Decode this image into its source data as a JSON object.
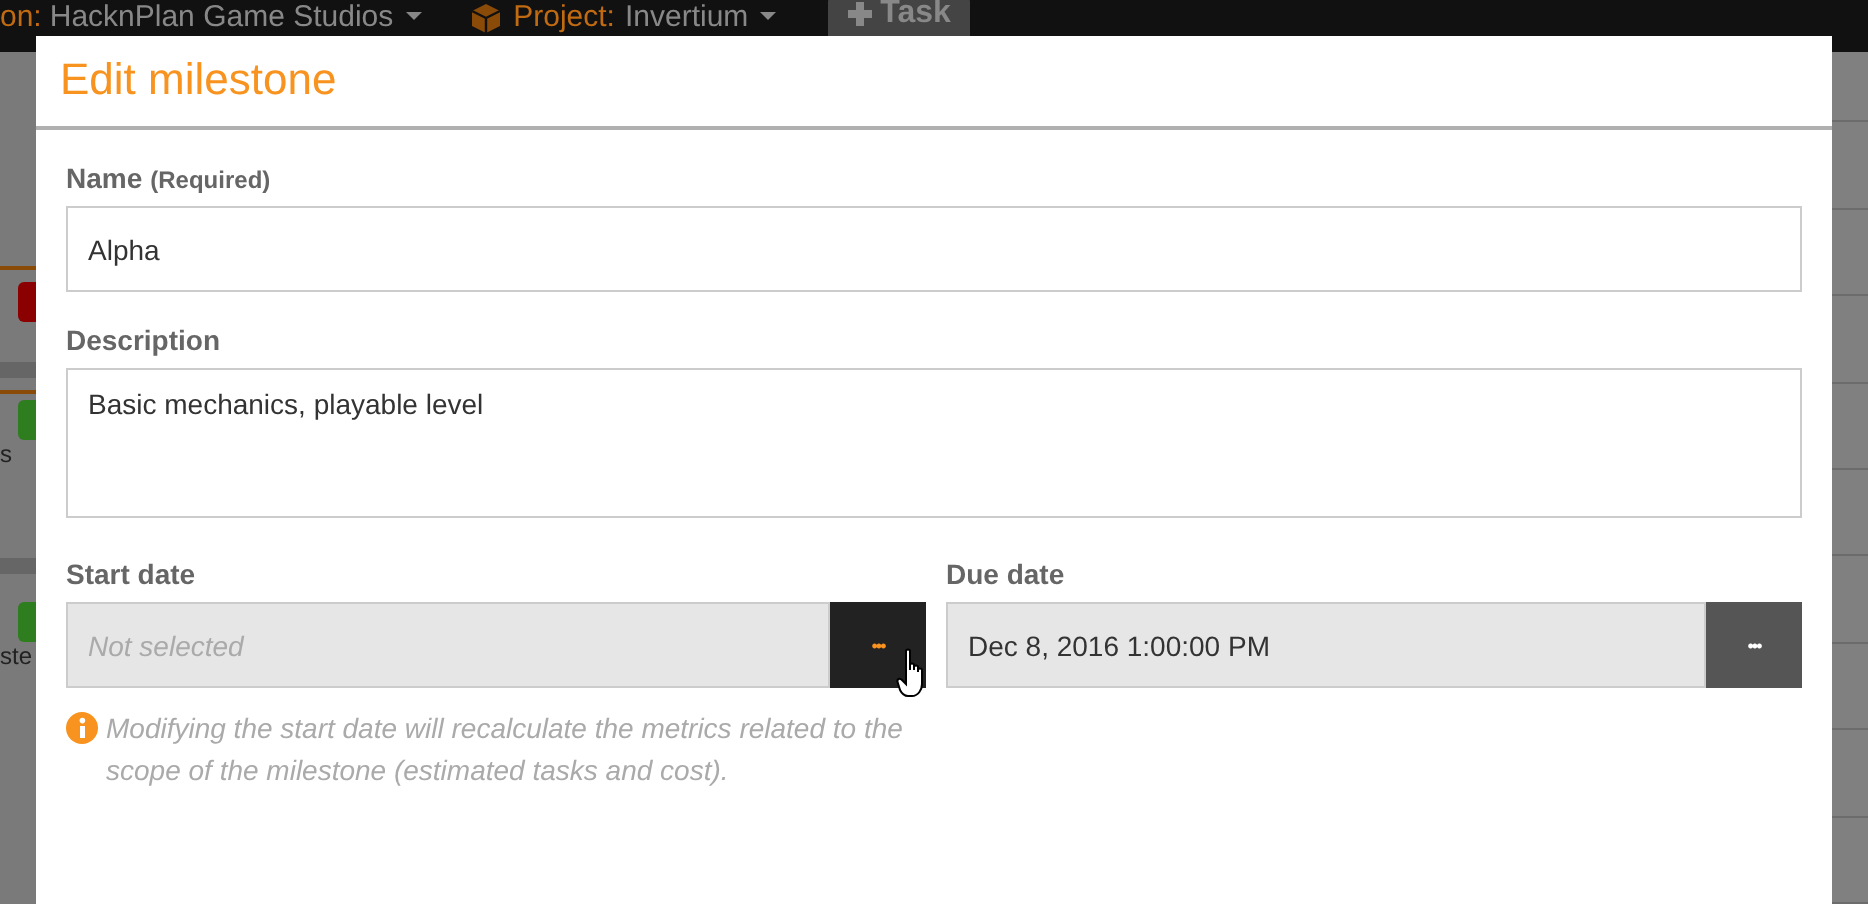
{
  "top_bar": {
    "organization_label": "on:",
    "organization": "HacknPlan Game Studios",
    "project_label": "Project:",
    "project": "Invertium",
    "task_button": "Task"
  },
  "background": {
    "list_texts": [
      "s",
      "ste"
    ]
  },
  "dialog": {
    "title": "Edit milestone",
    "name": {
      "label": "Name",
      "hint": "(Required)",
      "value": "Alpha"
    },
    "description": {
      "label": "Description",
      "value": "Basic mechanics, playable level"
    },
    "start_date": {
      "label": "Start date",
      "placeholder": "Not selected",
      "disabled": true,
      "button": "•••",
      "hovered": true
    },
    "due_date": {
      "label": "Due date",
      "value": "Dec 8, 2016 1:00:00 PM",
      "disabled": true,
      "button": "•••",
      "hovered": false
    },
    "note": "Modifying the start date will recalculate the metrics related to the scope of the milestone (estimated tasks and cost)."
  }
}
